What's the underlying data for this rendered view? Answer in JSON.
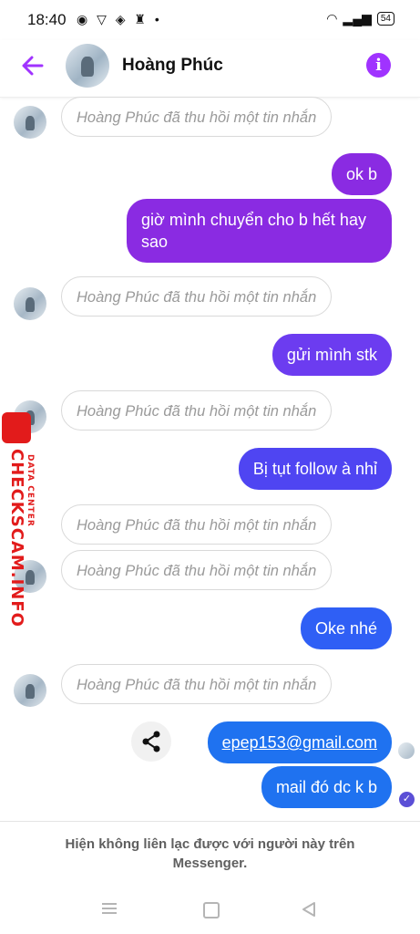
{
  "status_bar": {
    "time": "18:40",
    "battery": "54"
  },
  "header": {
    "contact_name": "Hoàng Phúc",
    "info_label": "i"
  },
  "messages": {
    "recalled_text": "Hoàng Phúc đã thu hồi một tin nhắn",
    "out_1": "ok b",
    "out_2": "giờ mình chuyển cho b hết hay sao",
    "out_3": "gửi mình stk",
    "out_4": "Bị tụt follow à nhỉ",
    "out_5": "Oke nhé",
    "out_6": "epep153@gmail.com",
    "out_7": "mail đó dc k b"
  },
  "watermark": {
    "brand": "CHECKSCAM.INFO",
    "sub": "DATA CENTER"
  },
  "footer": {
    "notice": "Hiện không liên lạc được với người này trên Messenger."
  },
  "colors": {
    "accent": "#a033ff",
    "bubble_purple": "#8a2be2",
    "bubble_blue": "#1f72f0"
  }
}
